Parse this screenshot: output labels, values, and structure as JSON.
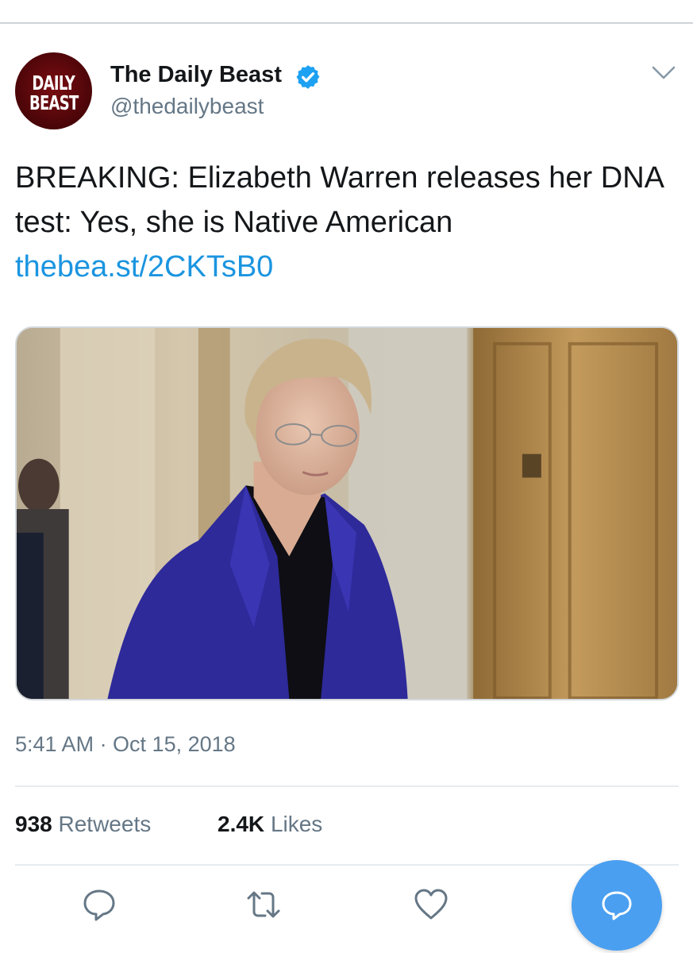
{
  "account": {
    "avatar_line_1": "DAILY",
    "avatar_line_2": "BEAST",
    "display_name": "The Daily Beast",
    "handle": "@thedailybeast",
    "verified": true
  },
  "tweet": {
    "text": "BREAKING: Elizabeth Warren releases her DNA test: Yes, she is Native American",
    "link": "thebea.st/2CKTsB0",
    "timestamp": "5:41 AM · Oct 15, 2018"
  },
  "stats": {
    "retweets_count": "938",
    "retweets_label": "Retweets",
    "likes_count": "2.4K",
    "likes_label": "Likes"
  },
  "icons": {
    "menu": "chevron-down-icon",
    "verified": "verified-badge-icon",
    "reply": "reply-icon",
    "retweet": "retweet-icon",
    "like": "heart-icon",
    "compose": "compose-reply-icon"
  },
  "colors": {
    "link": "#1b95e0",
    "secondary_text": "#657786",
    "verified": "#1da1f2",
    "fab": "#4a9ff0",
    "avatar_bg": "#5a070b"
  }
}
